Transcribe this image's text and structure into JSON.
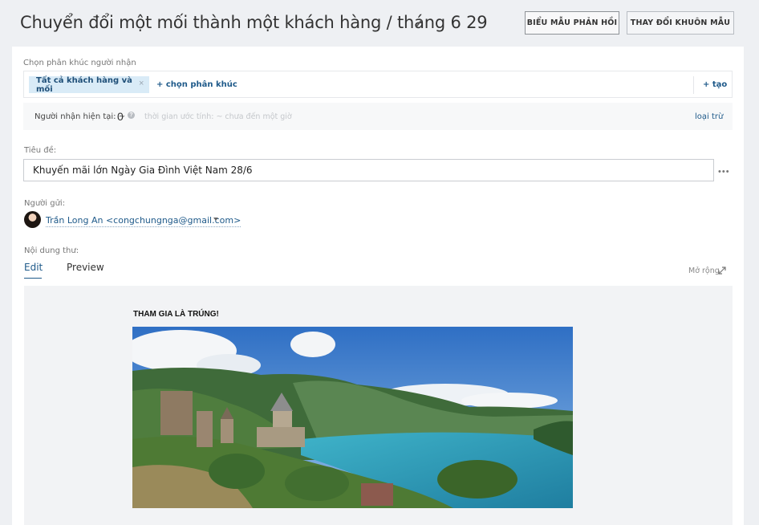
{
  "header": {
    "title": "Chuyển đổi một mối thành một khách hàng / tháng 6 29",
    "feedback_button": "BIỂU MẪU PHẢN HỒI",
    "change_template_button": "THAY ĐỔI KHUÔN MẪU"
  },
  "segments": {
    "label": "Chọn phân khúc người nhận",
    "selected_tag": "Tất cả khách hàng và mối",
    "remove_symbol": "×",
    "add_segment": "+ chọn phân khúc",
    "create": "+ tạo"
  },
  "recipients": {
    "label": "Người nhận hiện tại: ~",
    "count": "0",
    "estimate": "thời gian ước tính: ~ chưa đến một giờ",
    "exclude": "loại trừ"
  },
  "subject": {
    "label": "Tiêu đề:",
    "value": "Khuyến mãi lớn Ngày Gia Đình Việt Nam 28/6",
    "more": "•••"
  },
  "sender": {
    "label": "Người gửi:",
    "value": "Trần Long An <congchungnga@gmail.com>"
  },
  "content": {
    "label": "Nội dung thư:",
    "tabs": [
      "Edit",
      "Preview"
    ],
    "expand": "Mở rộng"
  },
  "email": {
    "heading": "THAM GIA LÀ TRÚNG!"
  },
  "colors": {
    "accent": "#1f5a8a",
    "tag_bg": "#d9ebf7",
    "page_bg": "#eef0f3"
  },
  "icons": [
    "pencil-icon",
    "help-icon",
    "more-icon",
    "caret-down-icon",
    "expand-icon"
  ]
}
